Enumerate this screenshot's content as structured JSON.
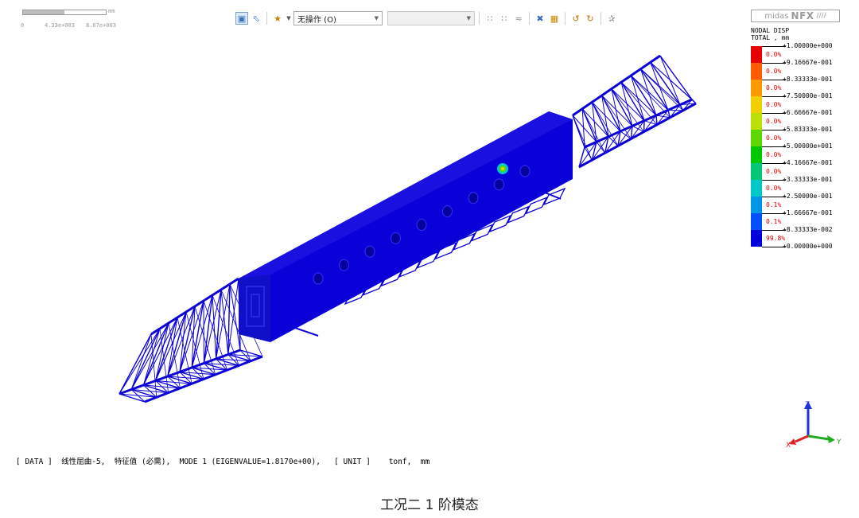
{
  "scale_bar": {
    "unit": "mm",
    "ticks": [
      "0",
      "4.33e+003",
      "8.67e+003"
    ]
  },
  "toolbar": {
    "operation_select": "无操作 (O)",
    "secondary_select": "",
    "icons": [
      "select-box-icon",
      "select-pointer-icon",
      "pick-dropdown-icon",
      "filter-icon",
      "node-filter-icon",
      "element-filter-icon",
      "cross-pick-icon",
      "display-toggle-icon",
      "rotate-left-icon",
      "rotate-right-icon",
      "pin-icon"
    ]
  },
  "logo": {
    "brand": "midas",
    "product": "NFX"
  },
  "legend": {
    "title_line1": "NODAL DISP",
    "title_line2": "TOTAL , mm",
    "colors": [
      "#e60000",
      "#ff5a00",
      "#ff9900",
      "#f2d000",
      "#b8e000",
      "#5ad800",
      "#00c800",
      "#00c878",
      "#00c8c8",
      "#0096e6",
      "#0050ff",
      "#0000dc"
    ],
    "values": [
      "+1.00000e+000",
      "+9.16667e-001",
      "+8.33333e-001",
      "+7.50000e-001",
      "+6.66667e-001",
      "+5.83333e-001",
      "+5.00000e+001",
      "+4.16667e-001",
      "+3.33333e-001",
      "+2.50000e-001",
      "+1.66667e-001",
      "+8.33333e-002",
      "+0.00000e+000"
    ],
    "percents": [
      "0.0%",
      "0.0%",
      "0.0%",
      "0.0%",
      "0.0%",
      "0.0%",
      "0.0%",
      "0.0%",
      "0.0%",
      "0.1%",
      "0.1%",
      "99.8%"
    ]
  },
  "axis": {
    "z": "Z",
    "x": "X",
    "y": "Y"
  },
  "status": {
    "text": "[ DATA ]  线性屈曲-5,  特征值 (必需),  MODE 1 (EIGENVALUE=1.8170e+00),   [ UNIT ]    tonf,  mm"
  },
  "caption": "工况二   1 阶模态",
  "model_color": "#0a00d8"
}
